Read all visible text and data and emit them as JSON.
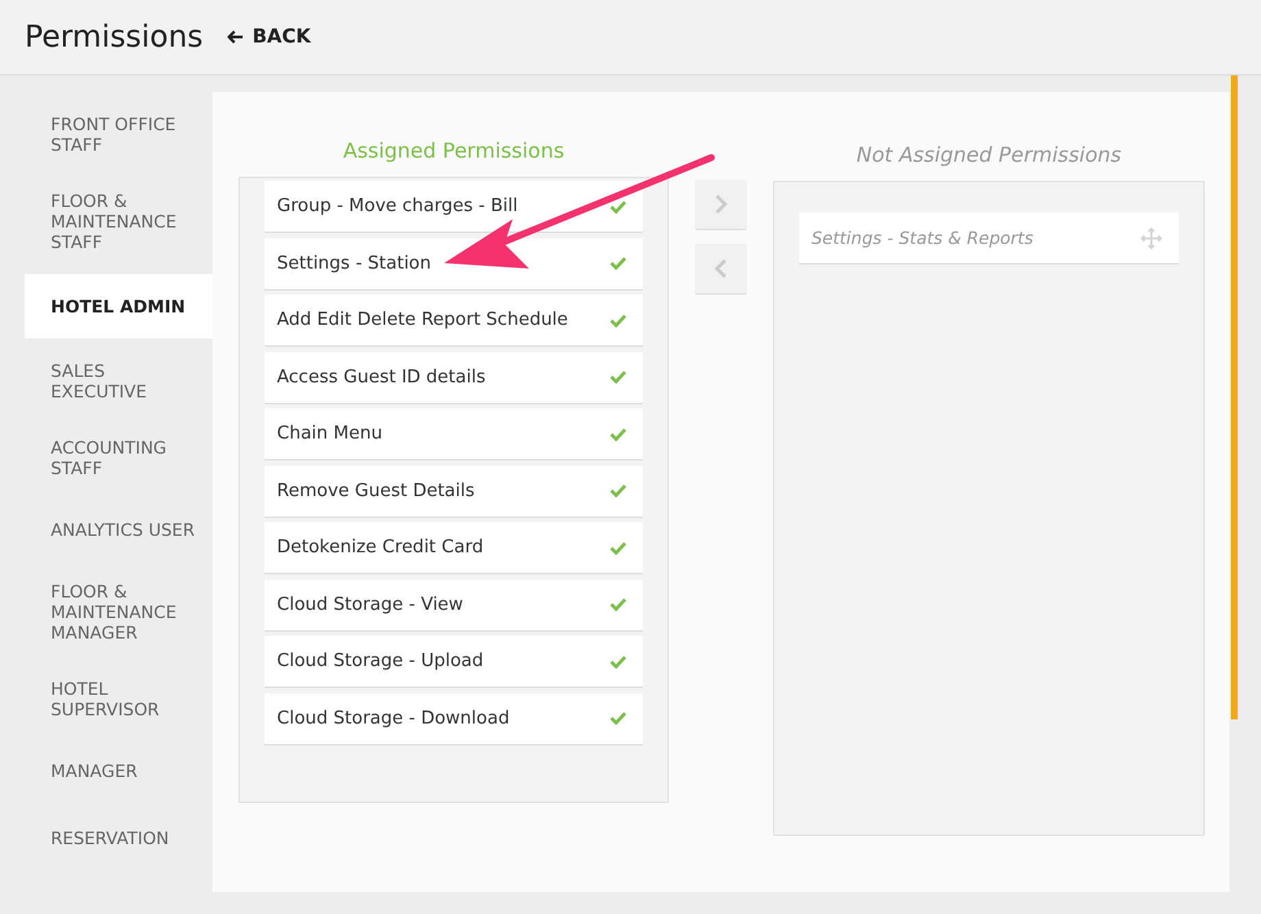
{
  "header": {
    "title": "Permissions",
    "back_label": "BACK"
  },
  "sidebar": {
    "items": [
      {
        "label": "FRONT OFFICE STAFF",
        "selected": false
      },
      {
        "label": "FLOOR & MAINTENANCE STAFF",
        "selected": false
      },
      {
        "label": "HOTEL ADMIN",
        "selected": true
      },
      {
        "label": "SALES EXECUTIVE",
        "selected": false
      },
      {
        "label": "ACCOUNTING STAFF",
        "selected": false
      },
      {
        "label": "ANALYTICS USER",
        "selected": false
      },
      {
        "label": "FLOOR & MAINTENANCE MANAGER",
        "selected": false
      },
      {
        "label": "HOTEL SUPERVISOR",
        "selected": false
      },
      {
        "label": "MANAGER",
        "selected": false
      },
      {
        "label": "RESERVATION",
        "selected": false
      }
    ]
  },
  "assigned": {
    "title": "Assigned Permissions",
    "items": [
      "Group - Move charges - Bill",
      "Settings - Station",
      "Add Edit Delete Report Schedule",
      "Access Guest ID details",
      "Chain Menu",
      "Remove Guest Details",
      "Detokenize Credit Card",
      "Cloud Storage - View",
      "Cloud Storage - Upload",
      "Cloud Storage - Download"
    ]
  },
  "not_assigned": {
    "title": "Not Assigned Permissions",
    "items": [
      "Settings - Stats & Reports"
    ]
  }
}
